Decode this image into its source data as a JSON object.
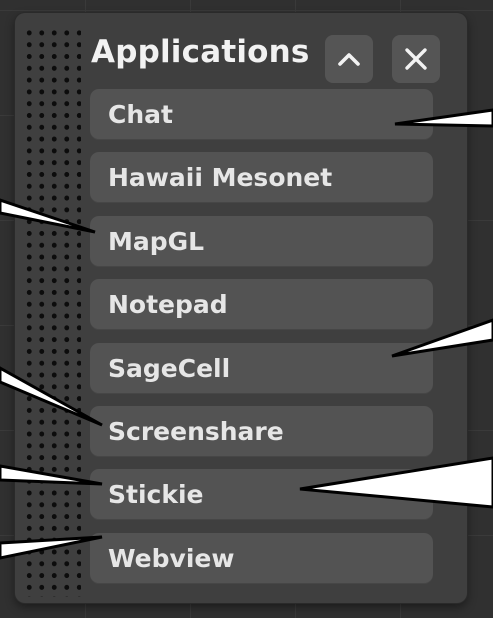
{
  "panel": {
    "title": "Applications",
    "collapse_icon": "chevron-up-icon",
    "close_icon": "close-icon"
  },
  "apps": [
    {
      "label": "Chat"
    },
    {
      "label": "Hawaii Mesonet"
    },
    {
      "label": "MapGL"
    },
    {
      "label": "Notepad"
    },
    {
      "label": "SageCell"
    },
    {
      "label": "Screenshare"
    },
    {
      "label": "Stickie"
    },
    {
      "label": "Webview"
    }
  ],
  "colors": {
    "background": "#303030",
    "panel": "#3f3f3f",
    "item": "#535353",
    "text": "#e6e6e6",
    "title": "#f2f2f2",
    "pointer": "#ffffff"
  }
}
